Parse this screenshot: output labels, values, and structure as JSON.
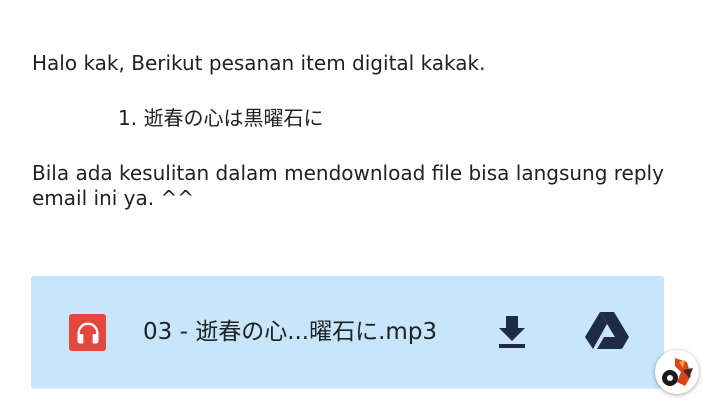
{
  "email": {
    "greeting": "Halo kak, Berikut pesanan item digital kakak.",
    "order_items": [
      {
        "label": "1. 逝春の心は黒曜石に"
      }
    ],
    "help_text": "Bila ada kesulitan dalam mendownload file bisa langsung reply email ini ya. ^^"
  },
  "attachment": {
    "file_name": "03 - 逝春の心...曜石に.mp3",
    "file_icon": "headphones-icon",
    "actions": {
      "download_icon": "download-icon",
      "drive_icon": "google-drive-icon"
    }
  },
  "colors": {
    "attachment_bg": "#c7e5fb",
    "file_icon_bg": "#e4473c",
    "action_icon": "#1f2a44"
  }
}
